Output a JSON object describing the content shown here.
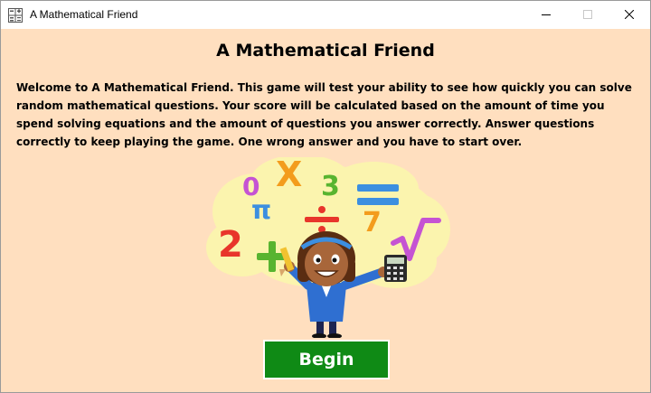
{
  "window": {
    "title": "A Mathematical Friend",
    "controls": [
      "minimize",
      "maximize",
      "close"
    ]
  },
  "main": {
    "heading": "A Mathematical Friend",
    "intro": "Welcome to A Mathematical Friend. This game will test your ability to see how quickly you can solve random mathematical questions. Your score will be calculated based on the amount of time you spend solving equations and the amount of questions you answer correctly. Answer questions correctly to keep playing the game. One wrong answer and you have to start over.",
    "begin_label": "Begin"
  },
  "illustration": {
    "symbols": [
      "0",
      "X",
      "3",
      "=",
      "π",
      "÷",
      "7",
      "√",
      "2",
      "+"
    ],
    "colors": {
      "cloud": "#fbf4ae",
      "orange": "#f39c1d",
      "green": "#58b430",
      "blue": "#3c8fe0",
      "purple": "#c553d3",
      "red": "#e8352b"
    }
  },
  "colors": {
    "background": "#ffdfbf",
    "button": "#0f8a15",
    "button_text": "#ffffff"
  }
}
